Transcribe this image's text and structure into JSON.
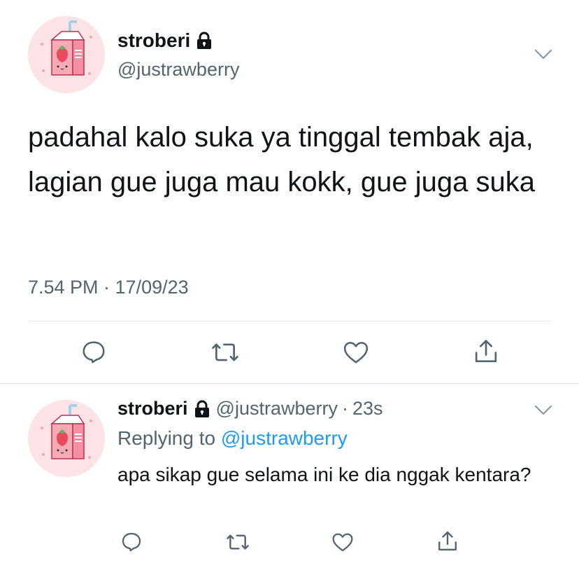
{
  "main_tweet": {
    "display_name": "stroberi",
    "handle": "@justrawberry",
    "text": "padahal kalo suka ya tinggal tembak aja, lagian gue juga mau kokk, gue juga suka",
    "timestamp": "7.54 PM · 17/09/23",
    "icons": {
      "avatar": "strawberry-milk-carton-avatar",
      "lock": "lock-icon",
      "menu": "chevron-down-icon",
      "reply": "reply-icon",
      "retweet": "retweet-icon",
      "like": "heart-icon",
      "share": "share-icon"
    }
  },
  "reply_tweet": {
    "display_name": "stroberi",
    "handle": "@justrawberry",
    "separator": "·",
    "time": "23s",
    "replying_prefix": "Replying to",
    "replying_to": "@justrawberry",
    "text": "apa sikap gue selama ini ke dia nggak kentara?"
  },
  "colors": {
    "text": "#0f1419",
    "secondary": "#536471",
    "link": "#1d9bf0",
    "divider": "#e1e8ed",
    "avatar_bg": "#fbe3e6"
  }
}
